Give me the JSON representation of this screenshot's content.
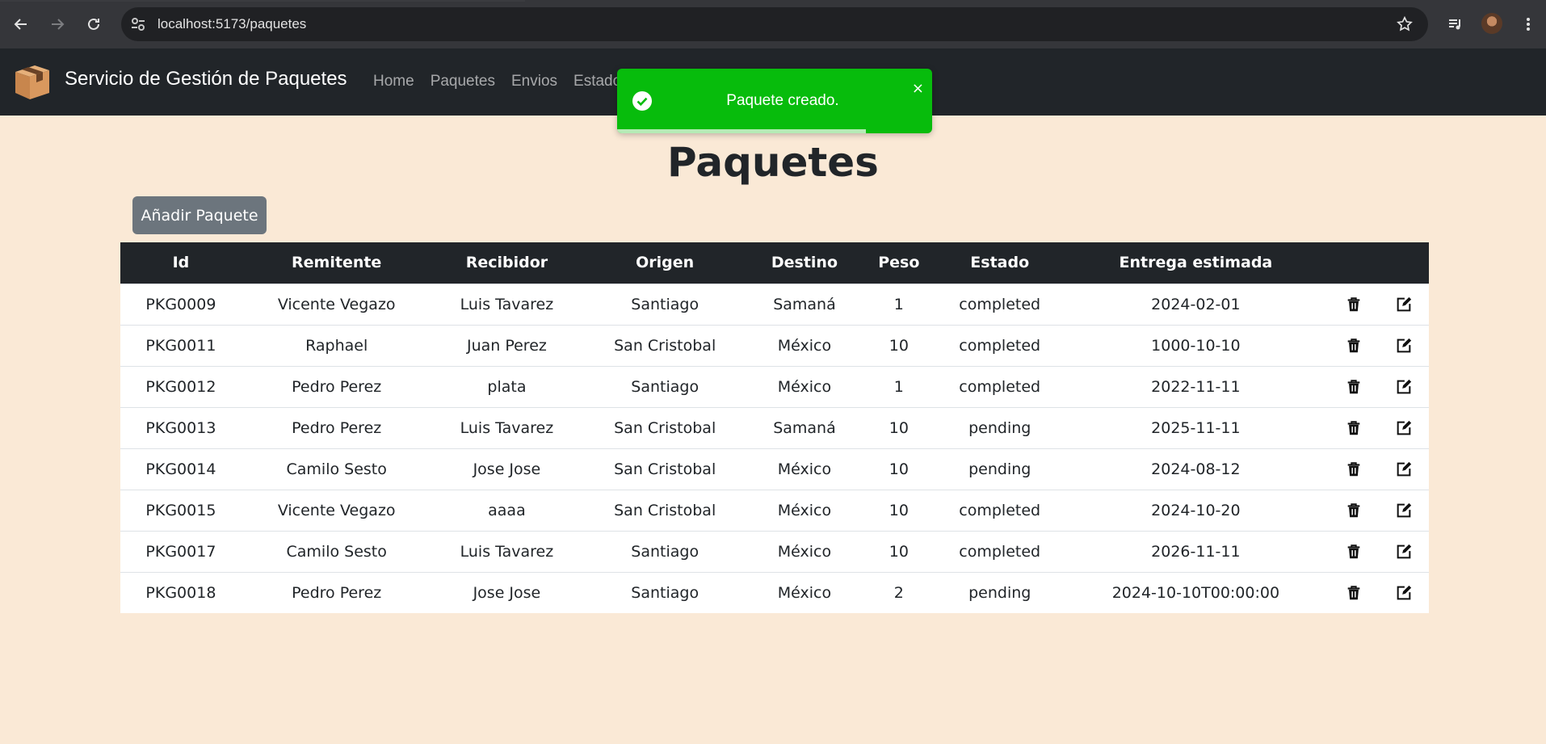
{
  "browser": {
    "url": "localhost:5173/paquetes"
  },
  "navbar": {
    "brand": "Servicio de Gestión de Paquetes",
    "links": [
      "Home",
      "Paquetes",
      "Envios",
      "Estados"
    ]
  },
  "toast": {
    "message": "Paquete creado.",
    "close_symbol": "×",
    "progress_fraction": 0.79
  },
  "main": {
    "title": "Paquetes",
    "add_button": "Añadir Paquete"
  },
  "table": {
    "headers": [
      "Id",
      "Remitente",
      "Recibidor",
      "Origen",
      "Destino",
      "Peso",
      "Estado",
      "Entrega estimada"
    ],
    "rows": [
      [
        "PKG0009",
        "Vicente Vegazo",
        "Luis Tavarez",
        "Santiago",
        "Samaná",
        "1",
        "completed",
        "2024-02-01"
      ],
      [
        "PKG0011",
        "Raphael",
        "Juan Perez",
        "San Cristobal",
        "México",
        "10",
        "completed",
        "1000-10-10"
      ],
      [
        "PKG0012",
        "Pedro Perez",
        "plata",
        "Santiago",
        "México",
        "1",
        "completed",
        "2022-11-11"
      ],
      [
        "PKG0013",
        "Pedro Perez",
        "Luis Tavarez",
        "San Cristobal",
        "Samaná",
        "10",
        "pending",
        "2025-11-11"
      ],
      [
        "PKG0014",
        "Camilo Sesto",
        "Jose Jose",
        "San Cristobal",
        "México",
        "10",
        "pending",
        "2024-08-12"
      ],
      [
        "PKG0015",
        "Vicente Vegazo",
        "aaaa",
        "San Cristobal",
        "México",
        "10",
        "completed",
        "2024-10-20"
      ],
      [
        "PKG0017",
        "Camilo Sesto",
        "Luis Tavarez",
        "Santiago",
        "México",
        "10",
        "completed",
        "2026-11-11"
      ],
      [
        "PKG0018",
        "Pedro Perez",
        "Jose Jose",
        "Santiago",
        "México",
        "2",
        "pending",
        "2024-10-10T00:00:00"
      ]
    ],
    "row_actions": [
      "trash-icon",
      "edit-icon"
    ]
  },
  "colors": {
    "page_bg": "#fae9d6",
    "navbar_bg": "#212529",
    "toast_bg": "#07bc0c",
    "button_bg": "#6c757d"
  }
}
